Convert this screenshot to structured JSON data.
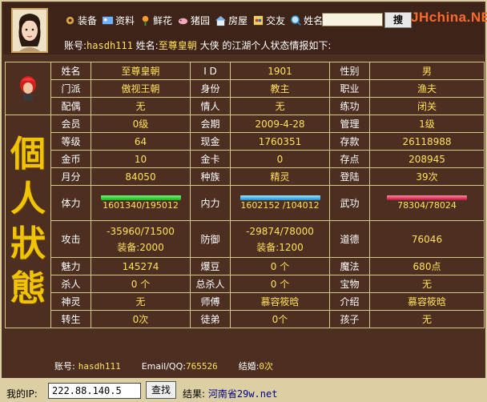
{
  "header": {
    "nav": [
      {
        "key": "equip",
        "label": "装备",
        "icon": "gear-icon"
      },
      {
        "key": "profile",
        "label": "资料",
        "icon": "profile-icon"
      },
      {
        "key": "flowers",
        "label": "鲜花",
        "icon": "flower-icon"
      },
      {
        "key": "pigfarm",
        "label": "猪园",
        "icon": "pig-icon"
      },
      {
        "key": "house",
        "label": "房屋",
        "icon": "house-icon"
      },
      {
        "key": "friends",
        "label": "交友",
        "icon": "friends-icon"
      },
      {
        "key": "name",
        "label": "姓名",
        "icon": "search-icon"
      }
    ],
    "search_value": "",
    "search_button": "搜",
    "brand": "JHchina.NET",
    "account_label": "账号:",
    "account": "hasdh111",
    "name_label": "姓名:",
    "name": "至尊皇朝",
    "title_word": "大侠",
    "info_suffix": "的江湖个人状态情报如下:"
  },
  "side_title": [
    "個",
    "人",
    "狀",
    "態"
  ],
  "stats": {
    "r1": {
      "l1": "姓名",
      "v1": "至尊皇朝",
      "l2": "I D",
      "v2": "1901",
      "l3": "性别",
      "v3": "男"
    },
    "r2": {
      "l1": "门派",
      "v1": "傲视王朝",
      "l2": "身份",
      "v2": "教主",
      "l3": "职业",
      "v3": "渔夫"
    },
    "r3": {
      "l1": "配偶",
      "v1": "无",
      "l2": "情人",
      "v2": "无",
      "l3": "练功",
      "v3": "闭关"
    },
    "r4": {
      "l1": "会员",
      "v1": "0级",
      "l2": "会期",
      "v2": "2009-4-28",
      "l3": "管理",
      "v3": "1级"
    },
    "r5": {
      "l1": "等级",
      "v1": "64",
      "l2": "现金",
      "v2": "1760351",
      "l3": "存款",
      "v3": "26118988"
    },
    "r6": {
      "l1": "金币",
      "v1": "10",
      "l2": "金卡",
      "v2": "0",
      "l3": "存点",
      "v3": "208945"
    },
    "r7": {
      "l1": "月分",
      "v1": "84050",
      "l2": "种族",
      "v2": "精灵",
      "l3": "登陆",
      "v3": "39次"
    },
    "r8": {
      "l1": "体力",
      "v1": "1601340/195012",
      "l2": "内力",
      "v2": "1602152 /104012",
      "l3": "武功",
      "v3": "78304/78024"
    },
    "r9": {
      "l1": "攻击",
      "v1a": "-35960/71500",
      "v1b": "装备:2000",
      "l2": "防御",
      "v2a": "-29874/78000",
      "v2b": "装备:1200",
      "l3": "道德",
      "v3": "76046"
    },
    "r10": {
      "l1": "魅力",
      "v1": "145274",
      "l2": "爆豆",
      "v2": "0 个",
      "l3": "魔法",
      "v3": "680点"
    },
    "r11": {
      "l1": "杀人",
      "v1": "0 个",
      "l2": "总杀人",
      "v2": "0 个",
      "l3": "宝物",
      "v3": "无"
    },
    "r12": {
      "l1": "神灵",
      "v1": "无",
      "l2": "师傅",
      "v2": "慕容筱晗",
      "l3": "介绍",
      "v3": "慕容筱晗"
    },
    "r13": {
      "l1": "转生",
      "v1": "0次",
      "l2": "徒弟",
      "v2": "0个",
      "l3": "孩子",
      "v3": "无"
    }
  },
  "footer": {
    "account_label": "账号:",
    "account": "hasdh111",
    "email_label": "Email/QQ:",
    "email": "765526",
    "married_label": "结婚:",
    "married": "0次"
  },
  "ipbar": {
    "label": "我的IP:",
    "ip": "222.88.140.5",
    "find_button": "查找",
    "result_label": "结果:",
    "result": "河南省29w.net"
  }
}
